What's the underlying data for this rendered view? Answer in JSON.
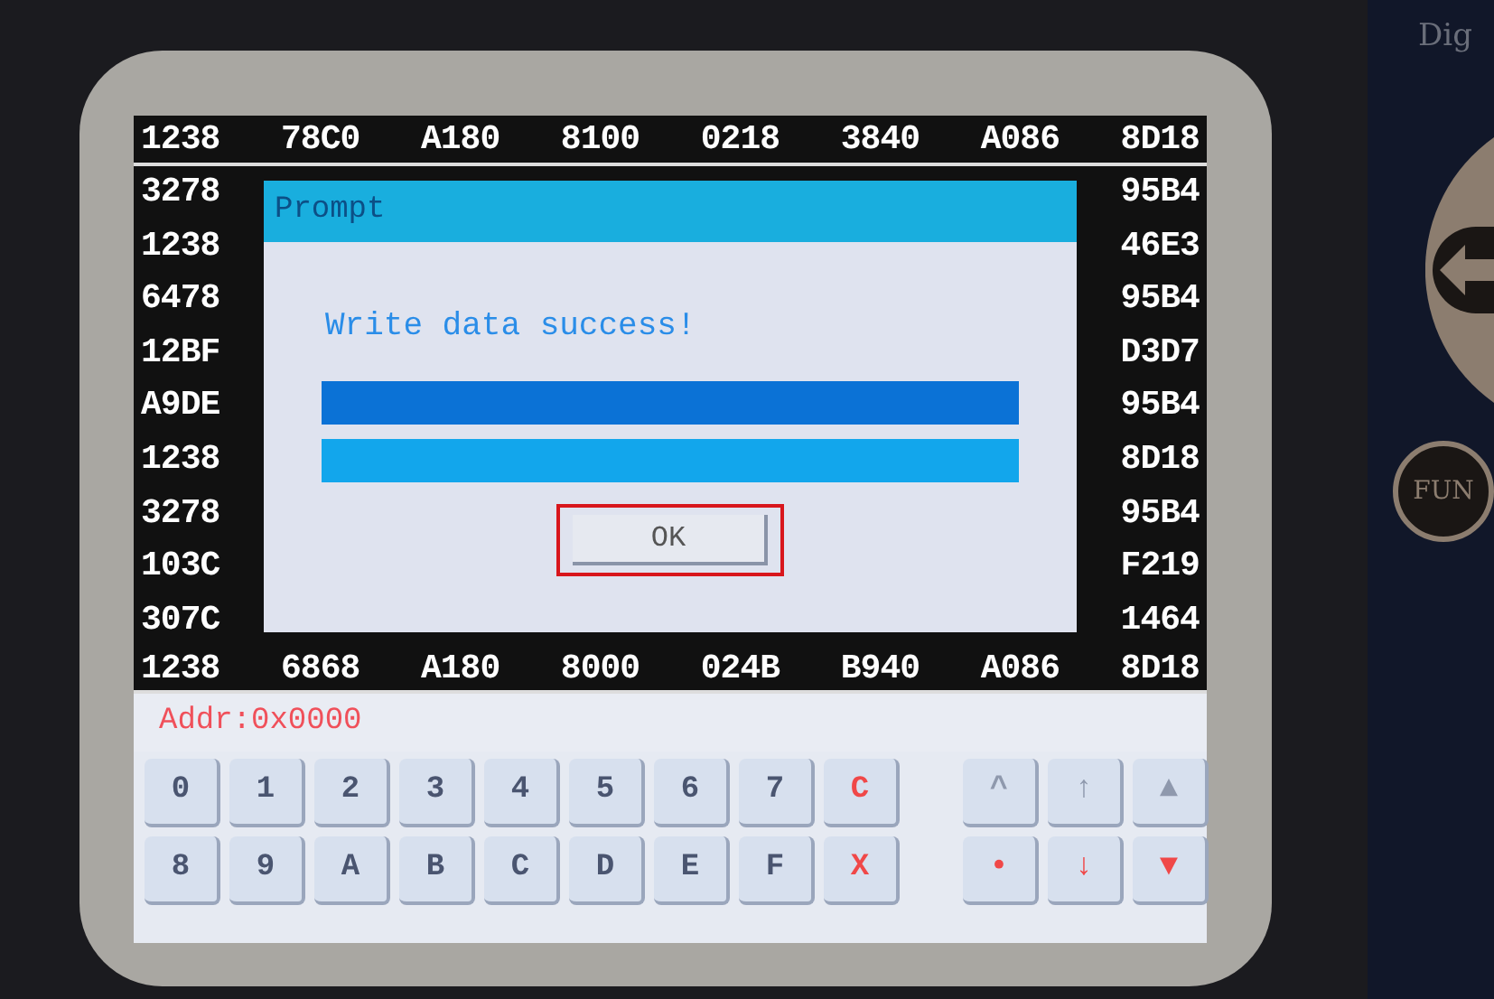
{
  "device": {
    "brand_text": "Dig",
    "side_buttons": [
      {
        "kind": "dpad"
      },
      {
        "kind": "text",
        "label": "FUN"
      }
    ]
  },
  "grid": {
    "top_row": [
      "1238",
      "78C0",
      "A180",
      "8100",
      "0218",
      "3840",
      "A086",
      "8D18"
    ],
    "left_column": [
      "3278",
      "1238",
      "6478",
      "12BF",
      "A9DE",
      "1238",
      "3278",
      "103C",
      "307C"
    ],
    "right_column": [
      "95B4",
      "46E3",
      "95B4",
      "D3D7",
      "95B4",
      "8D18",
      "95B4",
      "F219",
      "1464"
    ],
    "bottom_row": [
      "1238",
      "6868",
      "A180",
      "8000",
      "024B",
      "B940",
      "A086",
      "8D18"
    ]
  },
  "dialog": {
    "title": "Prompt",
    "message": "Write data success!",
    "bars": [
      {
        "color": "#0b72d6"
      },
      {
        "color": "#12a6ec"
      }
    ],
    "button": {
      "label": "OK",
      "focused": true
    }
  },
  "address": "Addr:0x0000",
  "keypad": [
    [
      {
        "label": "0",
        "kind": "hex",
        "disabled": false
      },
      {
        "label": "1",
        "kind": "hex",
        "disabled": false
      },
      {
        "label": "2",
        "kind": "hex",
        "disabled": false
      },
      {
        "label": "3",
        "kind": "hex",
        "disabled": false
      },
      {
        "label": "4",
        "kind": "hex",
        "disabled": false
      },
      {
        "label": "5",
        "kind": "hex",
        "disabled": false
      },
      {
        "label": "6",
        "kind": "hex",
        "disabled": false
      },
      {
        "label": "7",
        "kind": "hex",
        "disabled": false
      },
      {
        "label": "C",
        "kind": "action",
        "disabled": false
      },
      {
        "label": "^",
        "kind": "nav",
        "disabled": true
      },
      {
        "label": "↑",
        "kind": "nav",
        "disabled": true
      },
      {
        "label": "▲",
        "kind": "nav",
        "disabled": true
      }
    ],
    [
      {
        "label": "8",
        "kind": "hex",
        "disabled": false
      },
      {
        "label": "9",
        "kind": "hex",
        "disabled": false
      },
      {
        "label": "A",
        "kind": "hex",
        "disabled": false
      },
      {
        "label": "B",
        "kind": "hex",
        "disabled": false
      },
      {
        "label": "C",
        "kind": "hex",
        "disabled": false
      },
      {
        "label": "D",
        "kind": "hex",
        "disabled": false
      },
      {
        "label": "E",
        "kind": "hex",
        "disabled": false
      },
      {
        "label": "F",
        "kind": "hex",
        "disabled": false
      },
      {
        "label": "X",
        "kind": "action",
        "disabled": false
      },
      {
        "label": "•",
        "kind": "nav",
        "disabled": false
      },
      {
        "label": "↓",
        "kind": "nav",
        "disabled": false
      },
      {
        "label": "▼",
        "kind": "nav",
        "disabled": false
      }
    ]
  ]
}
